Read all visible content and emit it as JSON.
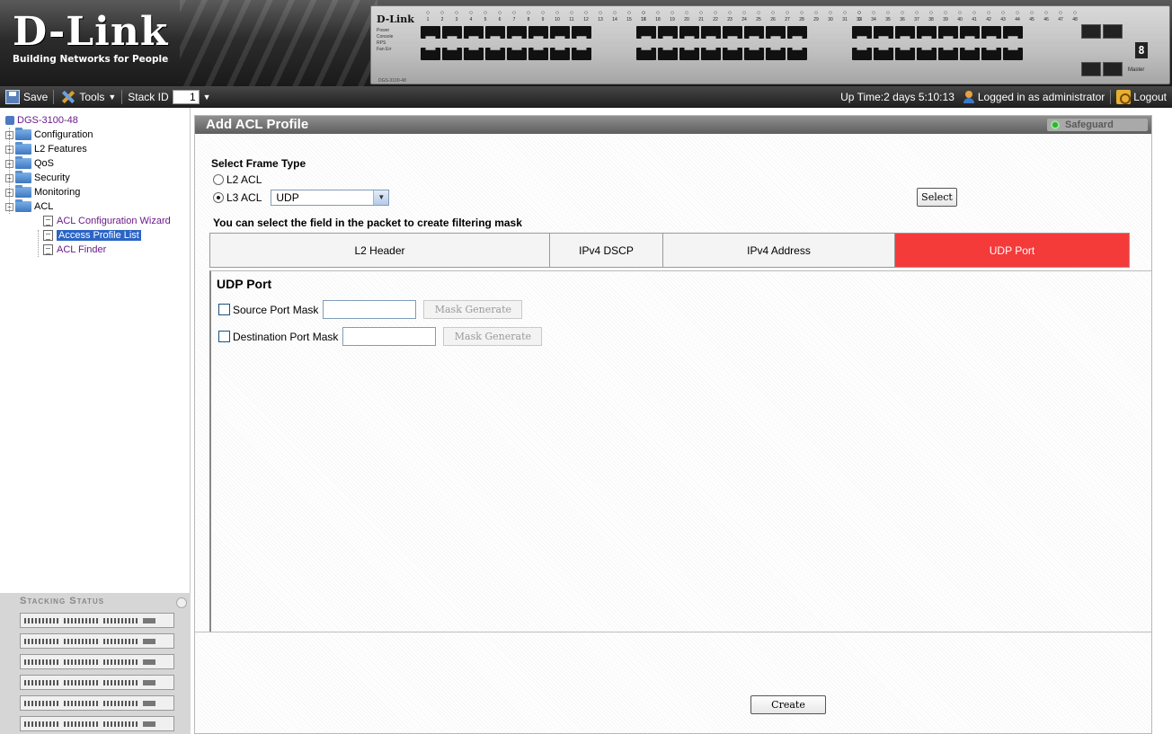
{
  "banner": {
    "logo_brand": "D-Link",
    "logo_tagline": "Building Networks for People",
    "panel_brand": "D-Link",
    "panel_leds": [
      "Power",
      "Console",
      "RPS",
      "Fan Err"
    ],
    "panel_model": "DGS-3100-48",
    "ports_group1": [
      "1",
      "2",
      "3",
      "4",
      "5",
      "6",
      "7",
      "8",
      "9",
      "10",
      "11",
      "12",
      "13",
      "14",
      "15",
      "16"
    ],
    "ports_group2": [
      "17",
      "18",
      "19",
      "20",
      "21",
      "22",
      "23",
      "24",
      "25",
      "26",
      "27",
      "28",
      "29",
      "30",
      "31",
      "32"
    ],
    "ports_group3": [
      "33",
      "34",
      "35",
      "36",
      "37",
      "38",
      "39",
      "40",
      "41",
      "42",
      "43",
      "44",
      "45",
      "46",
      "47",
      "48"
    ],
    "unit_digit": "8",
    "master_label": "Master"
  },
  "toolbar": {
    "save_label": "Save",
    "tools_label": "Tools",
    "stack_id_label": "Stack ID",
    "stack_id_value": "1",
    "uptime": "Up Time:2 days 5:10:13",
    "logged_in": "Logged in as administrator",
    "logout_label": "Logout"
  },
  "tree": {
    "root": "DGS-3100-48",
    "folders": [
      "Configuration",
      "L2 Features",
      "QoS",
      "Security",
      "Monitoring",
      "ACL"
    ],
    "acl_children": [
      "ACL Configuration Wizard",
      "Access Profile List",
      "ACL Finder"
    ]
  },
  "stacking": {
    "title": "Stacking Status",
    "units": 6
  },
  "main": {
    "title": "Add ACL Profile",
    "safeguard": "Safeguard",
    "frame_type_label": "Select Frame Type",
    "l2_acl": "L2 ACL",
    "l3_acl": "L3 ACL",
    "selected_frame": "L3 ACL",
    "protocol_value": "UDP",
    "select_button": "Select",
    "hint": "You can select the field in the packet to create filtering mask",
    "tabs": [
      "L2 Header",
      "IPv4 DSCP",
      "IPv4 Address",
      "UDP Port"
    ],
    "active_tab": "UDP Port",
    "udp_title": "UDP Port",
    "source_port_mask": "Source Port Mask",
    "destination_port_mask": "Destination Port Mask",
    "mask_generate": "Mask Generate",
    "create_button": "Create"
  },
  "colors": {
    "active_tab": "#f53a3a",
    "tree_link": "#6a1b8a",
    "selection": "#2a64c5",
    "safeguard_dot": "#2cb42c"
  }
}
